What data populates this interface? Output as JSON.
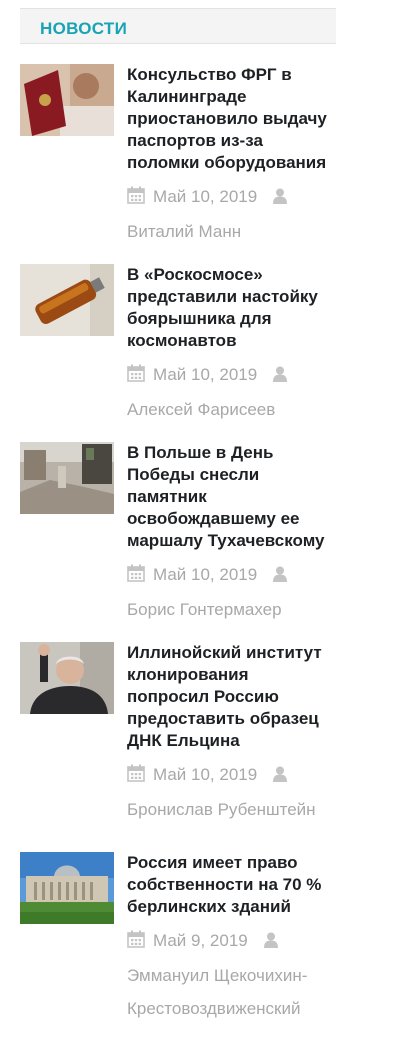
{
  "section": {
    "title": "НОВОСТИ"
  },
  "items": [
    {
      "title": "Консульство ФРГ в Калининграде приостановило выдачу паспортов из-за поломки оборудования",
      "date": "Май 10, 2019",
      "author": "Виталий Манн"
    },
    {
      "title": "В «Роскосмосе» представили настойку боярышника для космонавтов",
      "date": "Май 10, 2019",
      "author": "Алексей Фарисеев"
    },
    {
      "title": "В Польше в День Победы снесли памятник освобождавшему ее маршалу Тухачевскому",
      "date": "Май 10, 2019",
      "author": "Борис Гонтермахер"
    },
    {
      "title": "Иллинойский институт клонирования попросил Россию предоставить образец ДНК Ельцина",
      "date": "Май 10, 2019",
      "author": "Бронислав Рубенштейн"
    },
    {
      "title": "Россия имеет право собственности на 70 % берлинских зданий",
      "date": "Май 9, 2019",
      "author": "Эммануил Щекочихин-Крестовоздвиженский"
    }
  ],
  "icons": {
    "date": "calendar-icon",
    "author": "user-icon"
  },
  "colors": {
    "accent": "#17a4b5",
    "meta": "#a8a8a8",
    "title": "#1e2124"
  }
}
